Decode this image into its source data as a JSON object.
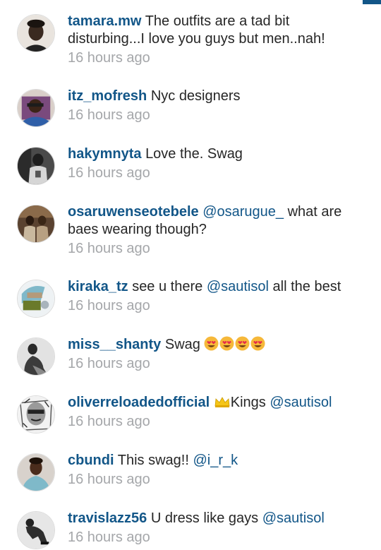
{
  "comments": [
    {
      "username": "tamara.mw",
      "text": "The outfits are a tad bit disturbing...I love you guys but men..nah!",
      "time": "16 hours ago"
    },
    {
      "username": "itz_mofresh",
      "text": "Nyc designers",
      "time": "16 hours ago"
    },
    {
      "username": "hakymnyta",
      "text": "Love the. Swag",
      "time": "16 hours ago"
    },
    {
      "username": "osaruwenseotebele",
      "mention": "@osarugue_",
      "text": "what are baes wearing though?",
      "time": "16 hours ago"
    },
    {
      "username": "kiraka_tz",
      "text": "see u there",
      "mention": "@sautisol",
      "text_after": "all the best",
      "time": "16 hours ago"
    },
    {
      "username": "miss__shanty",
      "text": "Swag",
      "emoji": "heart-eyes-emoji",
      "time": "16 hours ago"
    },
    {
      "username": "oliverreloadedofficial",
      "icon": "crown-icon",
      "text": "Kings",
      "mention": "@sautisol",
      "time": "16 hours ago"
    },
    {
      "username": "cbundi",
      "text": "This swag!!",
      "mention": "@i_r_k",
      "time": "16 hours ago"
    },
    {
      "username": "travislazz56",
      "text": "U dress like gays",
      "mention": "@sautisol",
      "time": "16 hours ago"
    }
  ],
  "colors": {
    "username": "#125688",
    "text": "#262626",
    "timestamp": "#a5a7aa"
  }
}
